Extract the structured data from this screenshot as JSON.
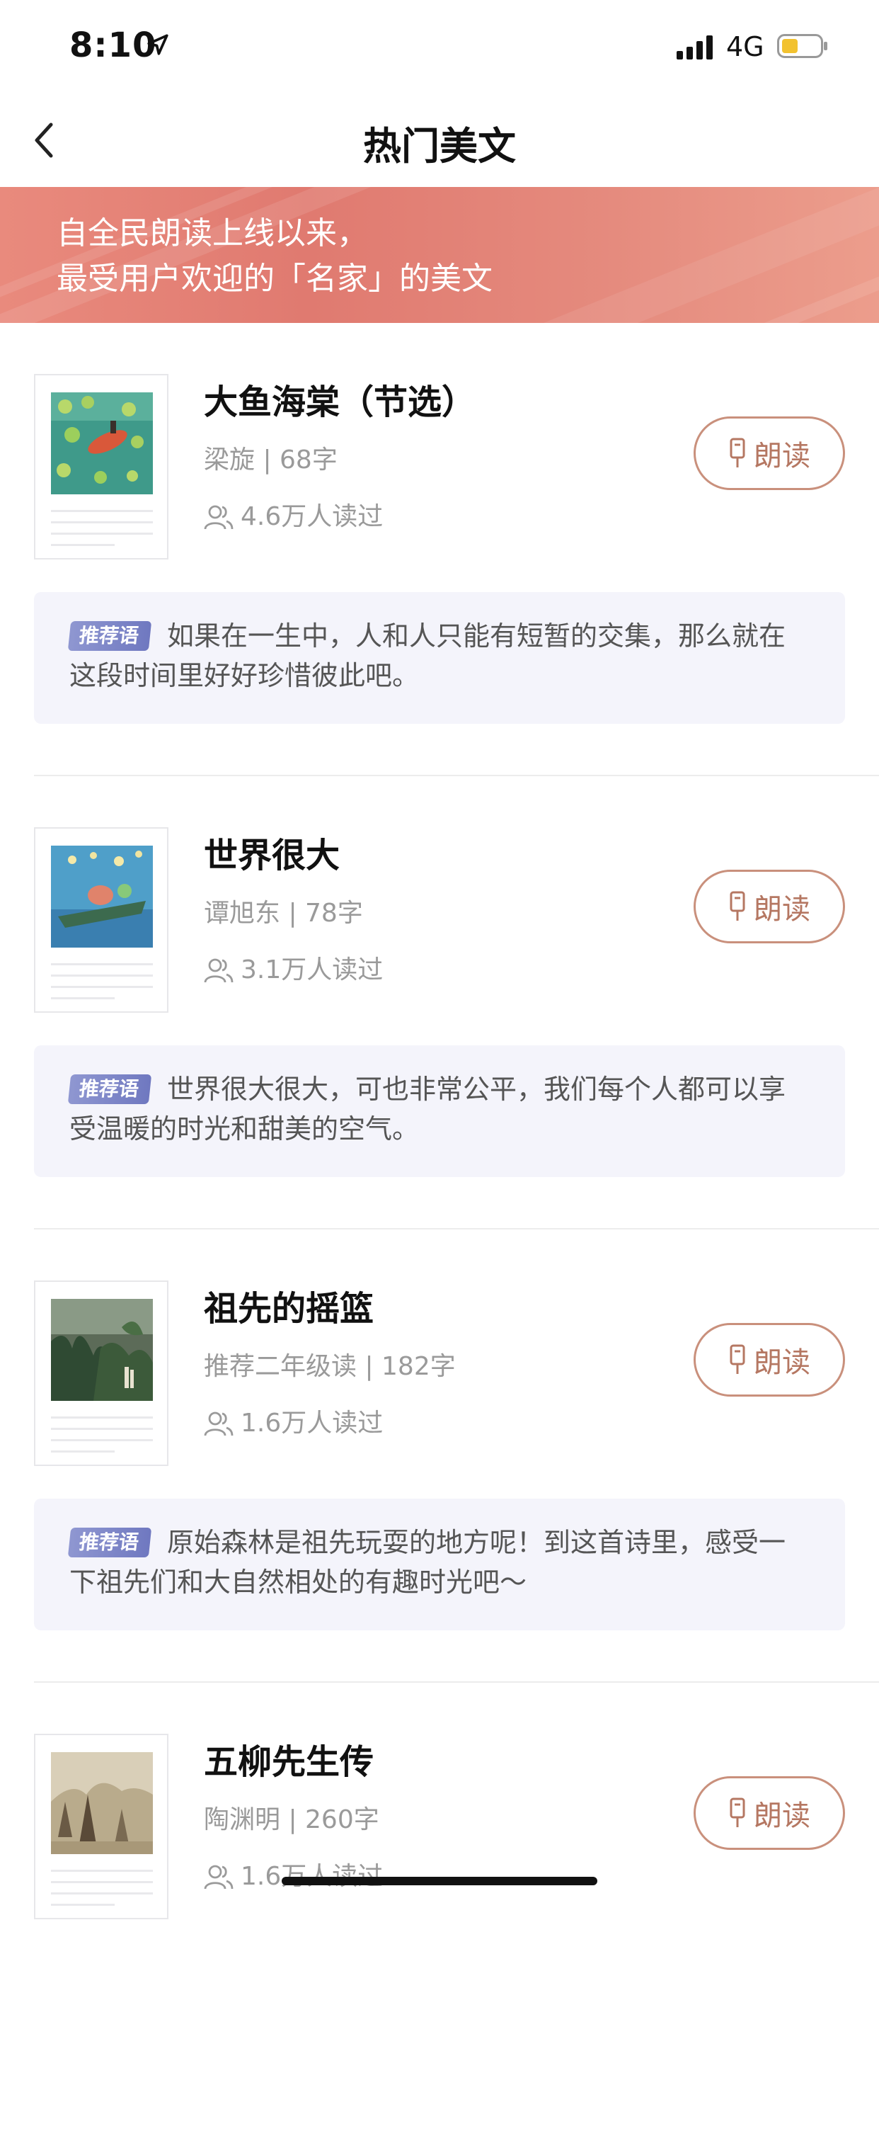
{
  "status_bar": {
    "time": "8:10",
    "network": "4G"
  },
  "nav": {
    "title": "热门美文"
  },
  "banner": {
    "line1": "自全民朗读上线以来，",
    "line2": "最受用户欢迎的「名家」的美文"
  },
  "labels": {
    "read_button": "朗读",
    "recommend_tag": "推荐语"
  },
  "colors": {
    "banner": "#e07a70",
    "accent": "#b57762",
    "tag": "#7078c0",
    "rec_bg": "#f4f4fb"
  },
  "articles": [
    {
      "title": "大鱼海棠（节选）",
      "meta": "梁旋 | 68字",
      "readers": "4.6万人读过",
      "recommend": "如果在一生中，人和人只能有短暂的交集，那么就在这段时间里好好珍惜彼此吧。"
    },
    {
      "title": "世界很大",
      "meta": "谭旭东 | 78字",
      "readers": "3.1万人读过",
      "recommend": "世界很大很大，可也非常公平，我们每个人都可以享受温暖的时光和甜美的空气。"
    },
    {
      "title": "祖先的摇篮",
      "meta": "推荐二年级读 | 182字",
      "readers": "1.6万人读过",
      "recommend": "原始森林是祖先玩耍的地方呢！到这首诗里，感受一下祖先们和大自然相处的有趣时光吧～"
    },
    {
      "title": "五柳先生传",
      "meta": "陶渊明 | 260字",
      "readers": "1.6万人读过"
    }
  ]
}
